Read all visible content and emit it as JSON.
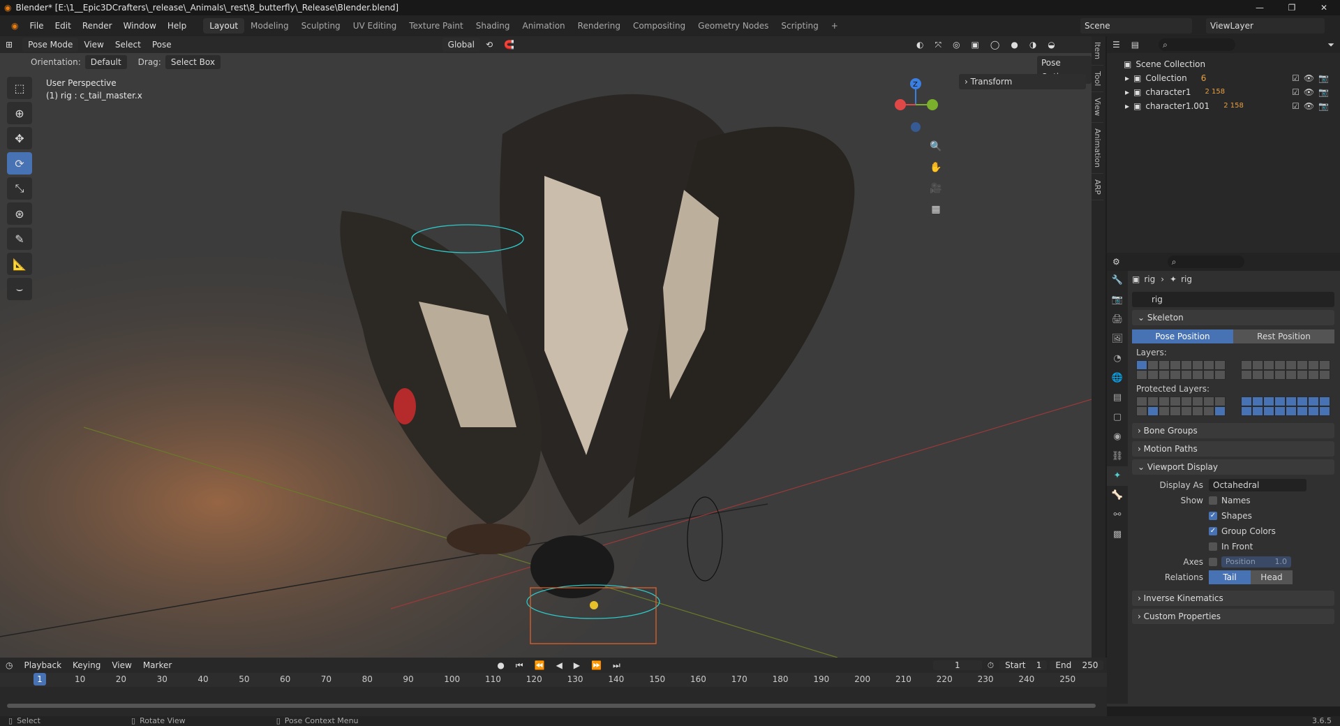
{
  "title": "Blender* [E:\\1__Epic3DCrafters\\_release\\_Animals\\_rest\\8_butterfly\\_Release\\Blender.blend]",
  "menu": [
    "File",
    "Edit",
    "Render",
    "Window",
    "Help"
  ],
  "workspaces": [
    "Layout",
    "Modeling",
    "Sculpting",
    "UV Editing",
    "Texture Paint",
    "Shading",
    "Animation",
    "Rendering",
    "Compositing",
    "Geometry Nodes",
    "Scripting",
    "+"
  ],
  "active_workspace": "Layout",
  "scene": "Scene",
  "view_layer": "ViewLayer",
  "viewport": {
    "mode": "Pose Mode",
    "menus": [
      "View",
      "Select",
      "Pose"
    ],
    "transform_orientation": "Global",
    "orientation_label": "Orientation:",
    "orientation_value": "Default",
    "drag_label": "Drag:",
    "drag_value": "Select Box",
    "pose_options": "Pose Options",
    "info_line1": "User Perspective",
    "info_line2": "(1) rig : c_tail_master.x",
    "transform_panel": "Transform",
    "gizmo_z": "Z",
    "npanel_tabs": [
      "Item",
      "Tool",
      "View",
      "Animation",
      "ARP"
    ]
  },
  "outliner": {
    "root": "Scene Collection",
    "items": [
      {
        "name": "Collection",
        "count": "6"
      },
      {
        "name": "character1",
        "count": "2  158"
      },
      {
        "name": "character1.001",
        "count": "2  158"
      }
    ]
  },
  "properties": {
    "breadcrumb_a": "rig",
    "breadcrumb_b": "rig",
    "data_name": "rig",
    "skeleton": "Skeleton",
    "pose_position": "Pose Position",
    "rest_position": "Rest Position",
    "layers_label": "Layers:",
    "protected_label": "Protected Layers:",
    "bone_groups": "Bone Groups",
    "motion_paths": "Motion Paths",
    "viewport_display": "Viewport Display",
    "display_as_label": "Display As",
    "display_as_value": "Octahedral",
    "show_label": "Show",
    "names": "Names",
    "shapes": "Shapes",
    "group_colors": "Group Colors",
    "in_front": "In Front",
    "axes_label": "Axes",
    "axes_position": "Position",
    "axes_value": "1.0",
    "relations_label": "Relations",
    "tail": "Tail",
    "head": "Head",
    "inverse_kinematics": "Inverse Kinematics",
    "custom_properties": "Custom Properties"
  },
  "timeline": {
    "menus": [
      "Playback",
      "Keying",
      "View",
      "Marker"
    ],
    "current_frame": "1",
    "start_label": "Start",
    "start": "1",
    "end_label": "End",
    "end": "250",
    "ticks": [
      "10",
      "20",
      "30",
      "40",
      "50",
      "60",
      "70",
      "80",
      "90",
      "100",
      "110",
      "120",
      "130",
      "140",
      "150",
      "160",
      "170",
      "180",
      "190",
      "200",
      "210",
      "220",
      "230",
      "240",
      "250"
    ]
  },
  "status": {
    "select": "Select",
    "rotate": "Rotate View",
    "context": "Pose Context Menu",
    "version": "3.6.5"
  },
  "colors": {
    "accent": "#4772b3",
    "logo": "#e87d0d"
  }
}
